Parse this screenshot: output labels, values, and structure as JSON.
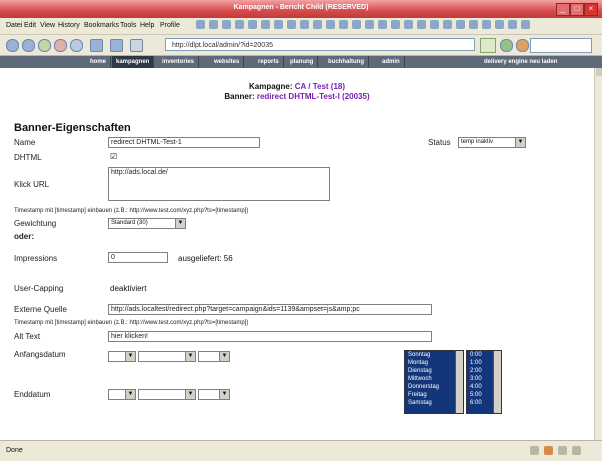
{
  "window": {
    "title": "Kampagnen - Bericht Child (RESERVED)"
  },
  "menu": [
    "Datei",
    "Edit",
    "View",
    "History",
    "Bookmarks",
    "Tools",
    "Help",
    "Profile"
  ],
  "url": "http://dlpt.local/admin/?id=20035",
  "tabs": [
    "home",
    "kampagnen",
    "inventories",
    "websites",
    "reports",
    "planung",
    "buchhaltung",
    "admin"
  ],
  "tab_right": "delivery engine neu laden",
  "header": {
    "kampagne_label": "Kampagne:",
    "kampagne_value": "CA / Test (18)",
    "banner_label": "Banner:",
    "banner_value": "redirect DHTML-Test-I (20035)"
  },
  "section_title": "Banner-Eigenschaften",
  "form": {
    "name_label": "Name",
    "name_value": "redirect DHTML-Test-1",
    "status_label": "Status",
    "status_value": "temp inaktiv",
    "dhtml_label": "DHTML",
    "dhtml_checked": "☑",
    "klick_label": "Klick URL",
    "klick_value": "http://ads.local.de/",
    "timestamp_note": "Timestamp mit [timestamp] einbauen (z.B.: http://www.test.com/xyz.php?ts=[timestamp])",
    "gewichtung_label": "Gewichtung",
    "gewichtung_value": "Standard (30)",
    "oder_label": "oder:",
    "impressions_label": "Impressions",
    "impressions_value": "0",
    "ausgeliefert_label": "ausgeliefert: 56",
    "capping_label": "User-Capping",
    "capping_value": "deaktiviert",
    "externe_label": "Externe Quelle",
    "externe_value": "http://ads.localtest/redirect.php?target=campaign&ids=1139&ampset=js&amp;pc",
    "timestamp_note2": "Timestamp mit [timestamp] einbauen (z.B.: http://www.test.com/xyz.php?ts=[timestamp])",
    "alt_label": "Alt Text",
    "alt_value": "hier klicken!",
    "anfang_label": "Anfangsdatum",
    "end_label": "Enddatum"
  },
  "weekdays": [
    "Sonntag",
    "Montag",
    "Dienstag",
    "Mittwoch",
    "Donnerstag",
    "Freitag",
    "Samstag"
  ],
  "hours": [
    "0:00",
    "1:00",
    "2:00",
    "3:00",
    "4:00",
    "5:00",
    "6:00"
  ],
  "statusbar": {
    "text": "Done"
  }
}
